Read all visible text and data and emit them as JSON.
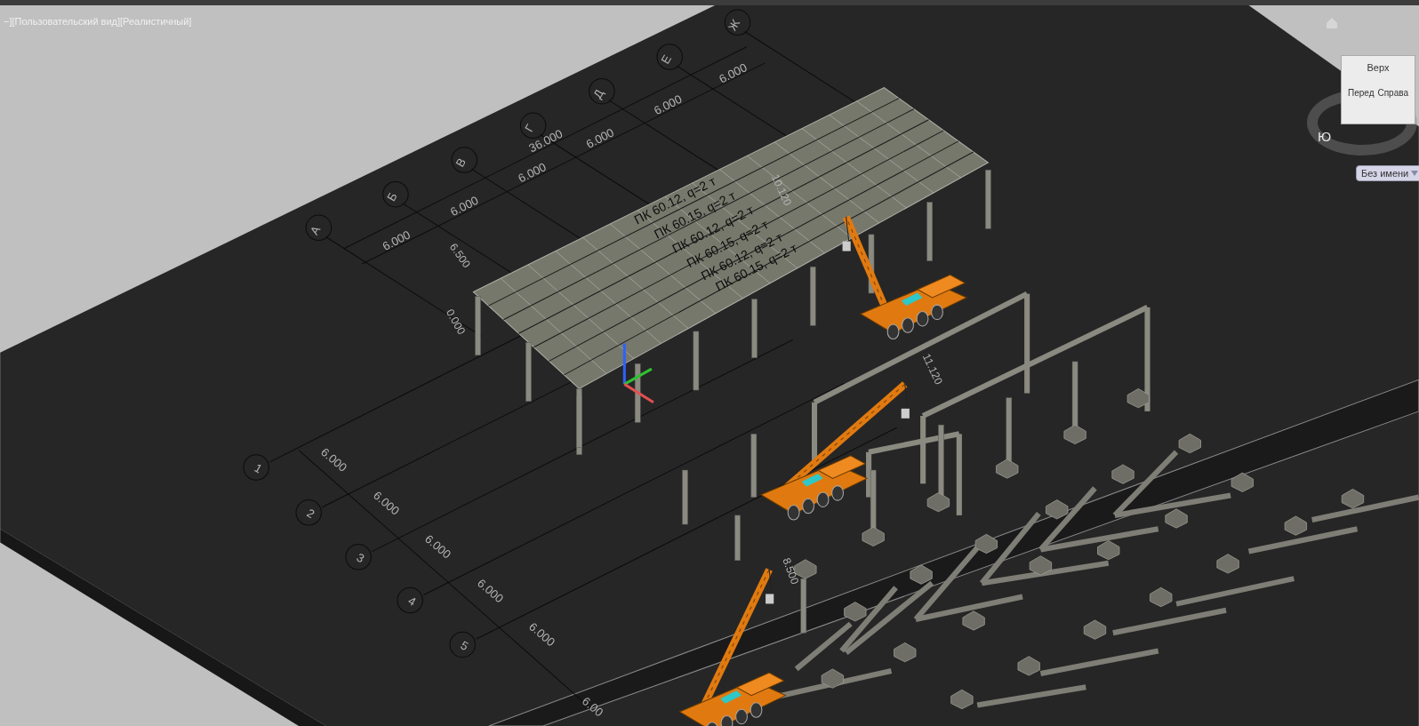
{
  "viewport": {
    "caption": "−][Пользовательский вид][Реалистичный]"
  },
  "grid_letters": [
    "А",
    "Б",
    "В",
    "Г",
    "Д",
    "Е",
    "Ж"
  ],
  "grid_numbers": [
    "1",
    "2",
    "3",
    "4",
    "5"
  ],
  "letter_dims": [
    "6.000",
    "6.000",
    "6.000",
    "6.000",
    "6.000",
    "6.000"
  ],
  "overall_dim": "36.000",
  "number_dims": [
    "6.000",
    "6.000",
    "6.000",
    "6.000",
    "6.000",
    "6.00"
  ],
  "roof_labels": [
    "ПК 60.12, q=2 т",
    "ПК 60.15, q=2 т",
    "ПК 60.12, q=2 т",
    "ПК 60.15, q=2 т",
    "ПК 60.12, q=2 т",
    "ПК 60.15, q=2 т"
  ],
  "level_marks": [
    "6.500",
    "0.000",
    "10.120",
    "11.120",
    "8.500"
  ],
  "viewcube": {
    "faces": [
      "Верх",
      "Перед",
      "Справа"
    ],
    "compass": "Ю",
    "ucs_menu": "Без имени"
  }
}
